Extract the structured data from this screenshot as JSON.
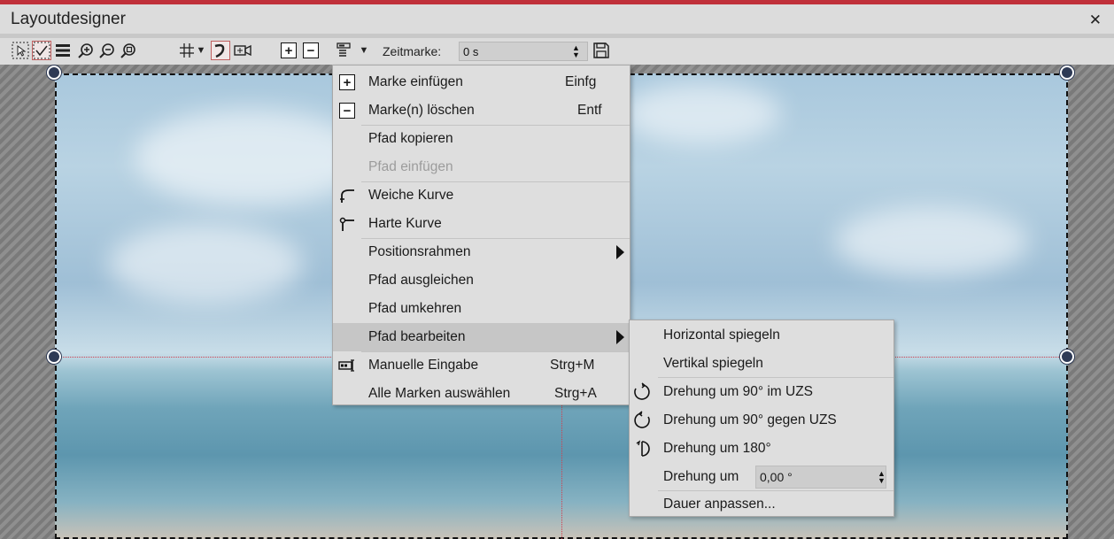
{
  "window": {
    "title": "Layoutdesigner",
    "close_glyph": "✕"
  },
  "toolbar": {
    "icons": [
      "select-icon",
      "curve-select-icon",
      "layers-icon",
      "zoom-in-icon",
      "zoom-out-icon",
      "zoom-fit-icon",
      "grid-icon",
      "dropdown-arrow-icon",
      "path-curve-icon",
      "camera-icon",
      "add-marker-icon",
      "remove-marker-icon",
      "path-menu-icon",
      "dropdown-arrow-icon",
      "save-icon"
    ],
    "zeitmarke_label": "Zeitmarke:",
    "zeitmarke_value": "0 s"
  },
  "context_menu": {
    "items": [
      {
        "label": "Marke einfügen",
        "shortcut": "Einfg",
        "icon": "plus-box-icon",
        "enabled": true
      },
      {
        "label": "Marke(n) löschen",
        "shortcut": "Entf",
        "icon": "minus-box-icon",
        "enabled": true
      },
      {
        "label": "Pfad kopieren",
        "shortcut": "",
        "icon": "",
        "enabled": true
      },
      {
        "label": "Pfad einfügen",
        "shortcut": "",
        "icon": "",
        "enabled": false
      },
      {
        "label": "Weiche Kurve",
        "shortcut": "",
        "icon": "soft-curve-icon",
        "enabled": true
      },
      {
        "label": "Harte Kurve",
        "shortcut": "",
        "icon": "hard-curve-icon",
        "enabled": true
      },
      {
        "label": "Positionsrahmen",
        "shortcut": "",
        "icon": "",
        "enabled": true,
        "submenu": true
      },
      {
        "label": "Pfad ausgleichen",
        "shortcut": "",
        "icon": "",
        "enabled": true
      },
      {
        "label": "Pfad umkehren",
        "shortcut": "",
        "icon": "",
        "enabled": true
      },
      {
        "label": "Pfad bearbeiten",
        "shortcut": "",
        "icon": "",
        "enabled": true,
        "submenu": true,
        "highlighted": true
      },
      {
        "label": "Manuelle Eingabe",
        "shortcut": "Strg+M",
        "icon": "manual-input-icon",
        "enabled": true
      },
      {
        "label": "Alle Marken auswählen",
        "shortcut": "Strg+A",
        "icon": "",
        "enabled": true
      }
    ]
  },
  "submenu": {
    "items": [
      {
        "label": "Horizontal spiegeln",
        "icon": ""
      },
      {
        "label": "Vertikal spiegeln",
        "icon": ""
      },
      {
        "label": "Drehung um 90° im UZS",
        "icon": "rotate-cw-icon"
      },
      {
        "label": "Drehung um 90° gegen UZS",
        "icon": "rotate-ccw-icon"
      },
      {
        "label": "Drehung um 180°",
        "icon": "rotate-180-icon"
      },
      {
        "label": "Drehung um",
        "icon": ""
      },
      {
        "label": "Dauer anpassen...",
        "icon": ""
      }
    ],
    "rotation_value": "0,00 °"
  }
}
